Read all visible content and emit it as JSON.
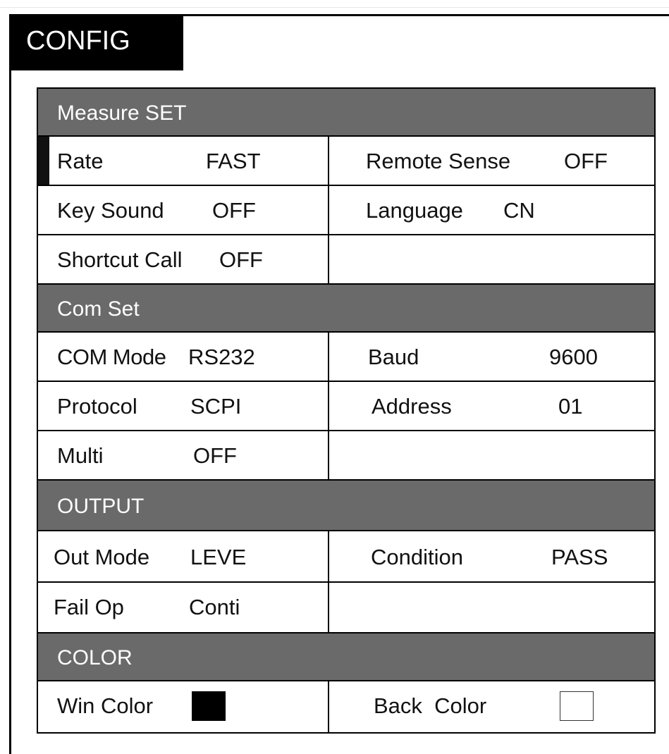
{
  "title": "CONFIG",
  "sections": {
    "measure": {
      "header": "Measure SET",
      "rate_label": "Rate",
      "rate_value": "FAST",
      "remote_label": "Remote Sense",
      "remote_value": "OFF",
      "key_sound_label": "Key Sound",
      "key_sound_value": "OFF",
      "language_label": "Language",
      "language_value": "CN",
      "shortcut_label": "Shortcut Call",
      "shortcut_value": "OFF"
    },
    "com": {
      "header": "Com  Set",
      "mode_label": "COM Mode",
      "mode_value": "RS232",
      "baud_label": "Baud",
      "baud_value": "9600",
      "protocol_label": "Protocol",
      "protocol_value": "SCPI",
      "address_label": "Address",
      "address_value": "01",
      "multi_label": "Multi",
      "multi_value": "OFF"
    },
    "output": {
      "header": "OUTPUT",
      "out_mode_label": "Out Mode",
      "out_mode_value": "LEVE",
      "condition_label": "Condition",
      "condition_value": "PASS",
      "fail_op_label": "Fail Op",
      "fail_op_value": "Conti"
    },
    "color": {
      "header": "COLOR",
      "win_label": "Win Color",
      "win_color": "#000000",
      "back_label": "Back  Color",
      "back_color": "#ffffff"
    }
  }
}
